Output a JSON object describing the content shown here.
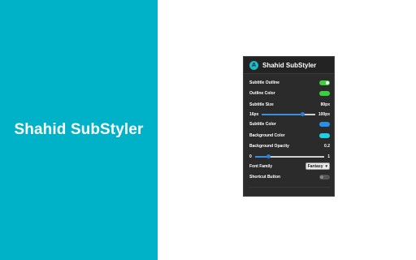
{
  "promo": {
    "title": "Shahid SubStyler"
  },
  "popup": {
    "logo_letter": "A",
    "title": "Shahid SubStyler",
    "subtitle_outline": {
      "label": "Subtitle Outline",
      "on": true
    },
    "outline_color": {
      "label": "Outline Color",
      "color": "#3ccf3c"
    },
    "subtitle_size": {
      "label": "Subtitle Size",
      "value": "80px",
      "min": "16px",
      "max": "100px",
      "fraction": 0.76
    },
    "subtitle_color": {
      "label": "Subtitle Color",
      "color": "#2a8fe6"
    },
    "background_color": {
      "label": "Background Color",
      "color": "#1fd1e0"
    },
    "background_opacity": {
      "label": "Background Opacity",
      "value": "0.2",
      "min": "0",
      "max": "1",
      "fraction": 0.2
    },
    "font_family": {
      "label": "Font Family",
      "selected": "Fantasy"
    },
    "shortcut_button": {
      "label": "Shortcut Button",
      "on": false
    }
  }
}
